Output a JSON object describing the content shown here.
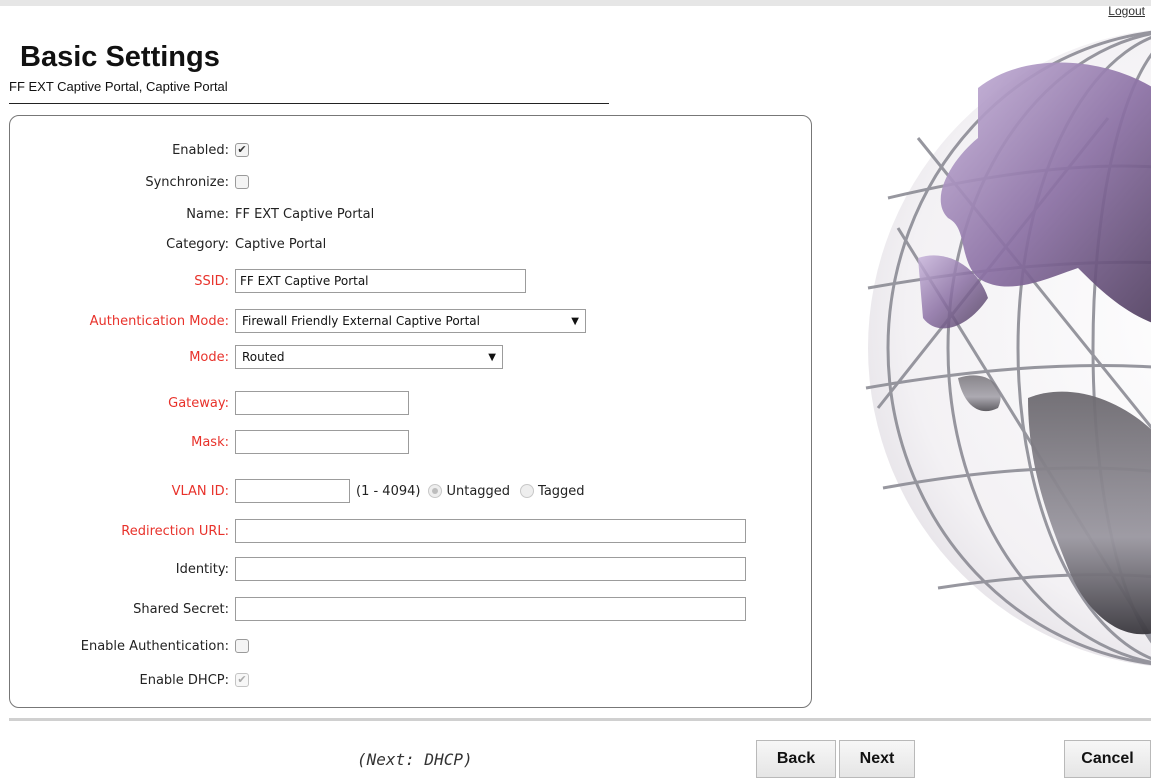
{
  "header": {
    "logout_label": "Logout"
  },
  "page": {
    "title": "Basic Settings",
    "subtitle": "FF EXT Captive Portal, Captive Portal"
  },
  "form": {
    "enabled": {
      "label": "Enabled:",
      "checked": true
    },
    "synchronize": {
      "label": "Synchronize:",
      "checked": false
    },
    "name": {
      "label": "Name:",
      "value": "FF EXT Captive Portal"
    },
    "category": {
      "label": "Category: ",
      "value": "Captive Portal"
    },
    "ssid": {
      "label": "SSID:",
      "value": "FF EXT Captive Portal"
    },
    "auth_mode": {
      "label": "Authentication Mode:",
      "value": "Firewall Friendly External Captive Portal"
    },
    "mode": {
      "label": "Mode:",
      "value": "Routed"
    },
    "gateway": {
      "label": "Gateway:",
      "value": ""
    },
    "mask": {
      "label": "Mask:",
      "value": ""
    },
    "vlan": {
      "label": "VLAN ID:",
      "value": "",
      "range_hint": "(1 - 4094)",
      "untagged_label": "Untagged",
      "tagged_label": "Tagged",
      "selected": "Untagged"
    },
    "redirection_url": {
      "label": "Redirection URL:",
      "value": ""
    },
    "identity": {
      "label": "Identity:",
      "value": ""
    },
    "shared_secret": {
      "label": "Shared Secret:",
      "value": ""
    },
    "enable_auth": {
      "label": "Enable Authentication:",
      "checked": false
    },
    "enable_dhcp": {
      "label": "Enable DHCP:",
      "checked": true,
      "disabled": true
    }
  },
  "footer": {
    "next_hint": "(Next: DHCP)",
    "back_label": "Back",
    "next_label": "Next",
    "cancel_label": "Cancel"
  },
  "colors": {
    "required_label": "#e8322b",
    "globe_purple": "#8a6fa3"
  }
}
